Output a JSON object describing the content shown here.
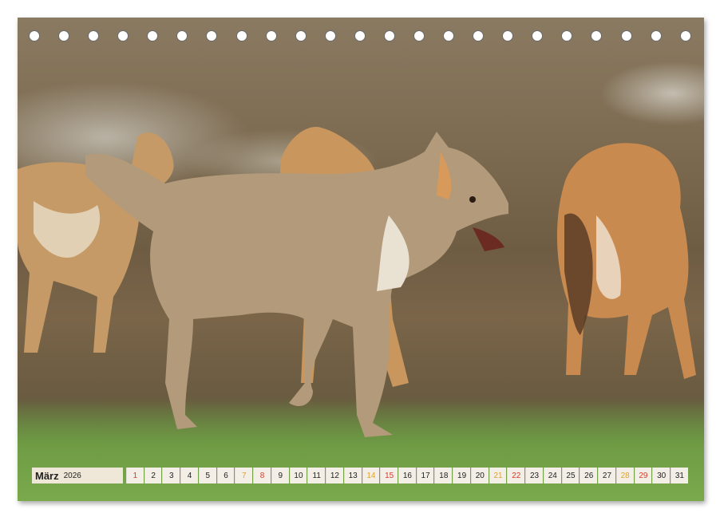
{
  "calendar": {
    "month": "März",
    "year": "2026",
    "days": [
      {
        "n": "1",
        "kind": "sun"
      },
      {
        "n": "2",
        "kind": "wd"
      },
      {
        "n": "3",
        "kind": "wd"
      },
      {
        "n": "4",
        "kind": "wd"
      },
      {
        "n": "5",
        "kind": "wd"
      },
      {
        "n": "6",
        "kind": "wd"
      },
      {
        "n": "7",
        "kind": "sat"
      },
      {
        "n": "8",
        "kind": "sun"
      },
      {
        "n": "9",
        "kind": "wd"
      },
      {
        "n": "10",
        "kind": "wd"
      },
      {
        "n": "11",
        "kind": "wd"
      },
      {
        "n": "12",
        "kind": "wd"
      },
      {
        "n": "13",
        "kind": "wd"
      },
      {
        "n": "14",
        "kind": "sat"
      },
      {
        "n": "15",
        "kind": "sun"
      },
      {
        "n": "16",
        "kind": "wd"
      },
      {
        "n": "17",
        "kind": "wd"
      },
      {
        "n": "18",
        "kind": "wd"
      },
      {
        "n": "19",
        "kind": "wd"
      },
      {
        "n": "20",
        "kind": "wd"
      },
      {
        "n": "21",
        "kind": "sat"
      },
      {
        "n": "22",
        "kind": "sun"
      },
      {
        "n": "23",
        "kind": "wd"
      },
      {
        "n": "24",
        "kind": "wd"
      },
      {
        "n": "25",
        "kind": "wd"
      },
      {
        "n": "26",
        "kind": "wd"
      },
      {
        "n": "27",
        "kind": "wd"
      },
      {
        "n": "28",
        "kind": "sat"
      },
      {
        "n": "29",
        "kind": "sun"
      },
      {
        "n": "30",
        "kind": "wd"
      },
      {
        "n": "31",
        "kind": "wd"
      }
    ]
  },
  "binding": {
    "hole_count": 23
  },
  "colors": {
    "sunday": "#d93a2b",
    "saturday": "#e0a22c",
    "strip": "#f4efe6"
  }
}
